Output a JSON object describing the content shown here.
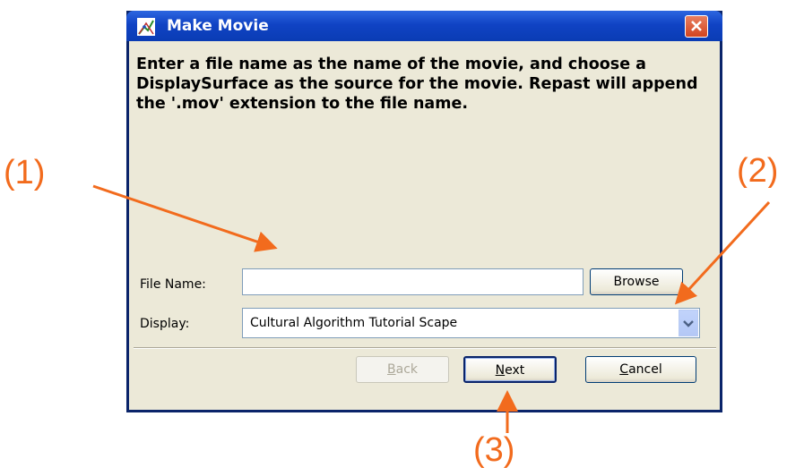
{
  "window": {
    "title": "Make Movie",
    "icon": "repast-app-icon",
    "close_icon": "close-icon"
  },
  "instructions": "Enter a file name as the name of the movie, and choose a DisplaySurface as the source for the movie. Repast will append the '.mov' extension to the file name.",
  "file_name": {
    "label": "File Name:",
    "value": "",
    "browse_label": "Browse"
  },
  "display": {
    "label": "Display:",
    "selected": "Cultural Algorithm Tutorial Scape",
    "arrow_icon": "chevron-down-icon"
  },
  "buttons": {
    "back": {
      "mnemonic": "B",
      "rest": "ack",
      "enabled": false
    },
    "next": {
      "mnemonic": "N",
      "rest": "ext",
      "enabled": true
    },
    "cancel": {
      "mnemonic": "C",
      "rest": "ancel",
      "enabled": true
    }
  },
  "callouts": [
    "(1)",
    "(2)",
    "(3)"
  ],
  "colors": {
    "callout": "#f26b1d",
    "titlebar": "#0a3cb4",
    "dialog_bg": "#ece9d8"
  }
}
